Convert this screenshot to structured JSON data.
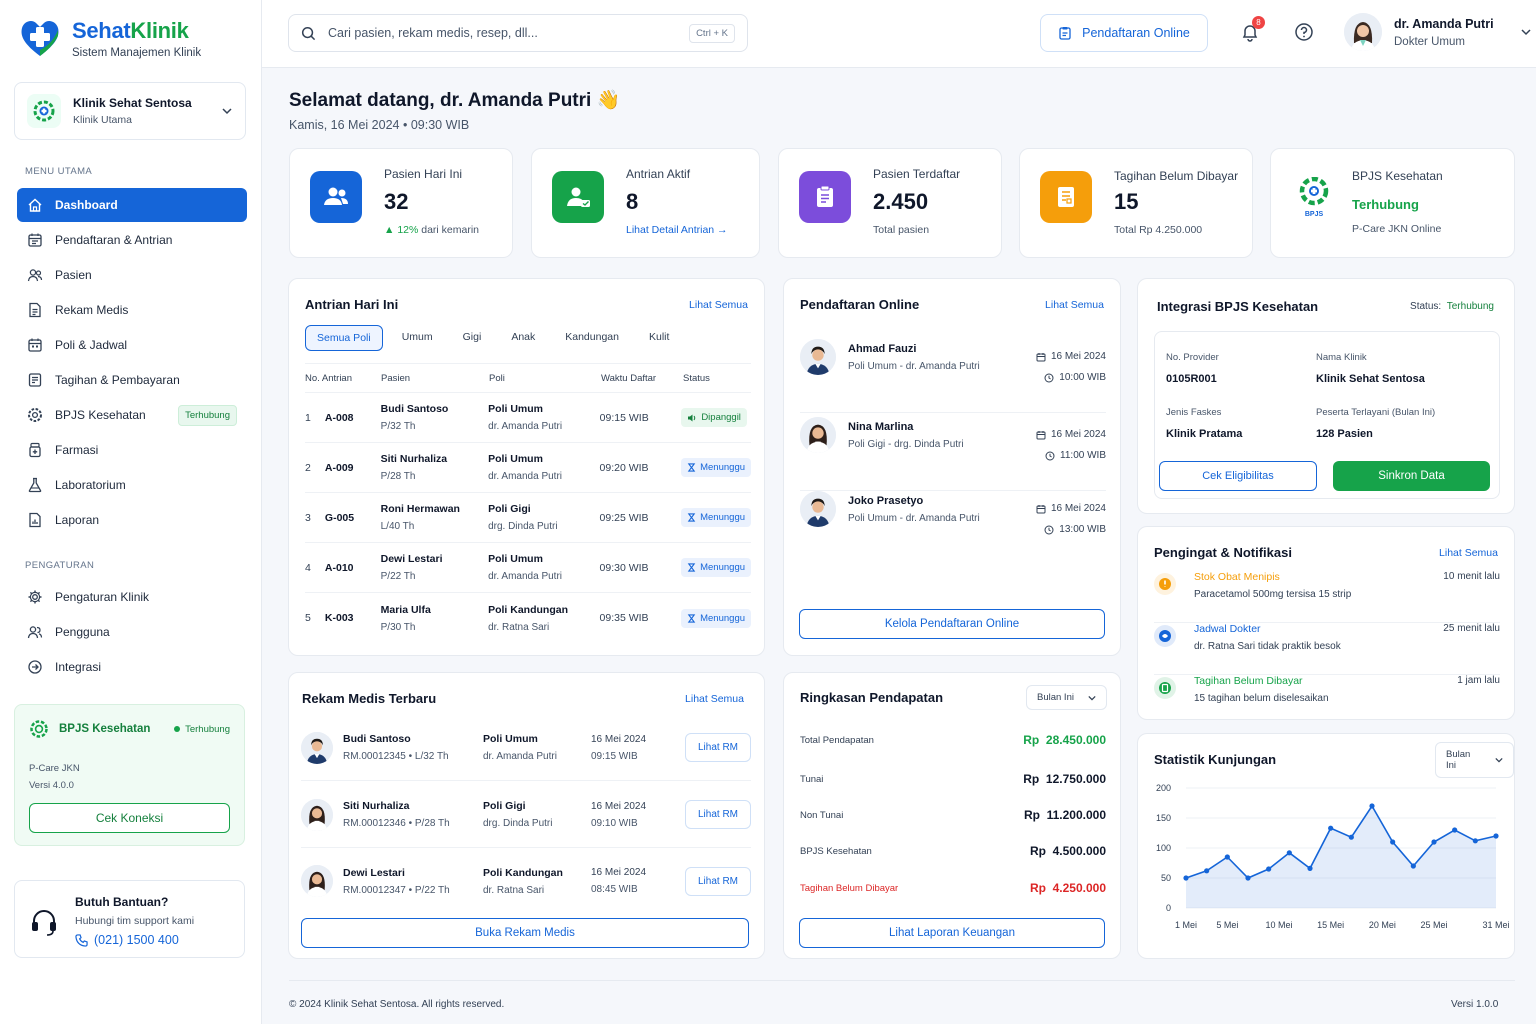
{
  "brand": {
    "name_part1": "Sehat",
    "name_part2": "Klinik",
    "subtitle": "Sistem Manajemen Klinik"
  },
  "clinic": {
    "name": "Klinik Sehat Sentosa",
    "type": "Klinik Utama"
  },
  "sidebar": {
    "menu_heading": "MENU UTAMA",
    "items": [
      {
        "label": "Dashboard",
        "icon": "home-icon",
        "active": true
      },
      {
        "label": "Pendaftaran & Antrian",
        "icon": "calendar-list-icon"
      },
      {
        "label": "Pasien",
        "icon": "users-icon"
      },
      {
        "label": "Rekam Medis",
        "icon": "document-icon"
      },
      {
        "label": "Poli & Jadwal",
        "icon": "calendar-icon"
      },
      {
        "label": "Tagihan & Pembayaran",
        "icon": "invoice-icon"
      },
      {
        "label": "BPJS Kesehatan",
        "icon": "gear-badge-icon",
        "badge": "Terhubung"
      },
      {
        "label": "Farmasi",
        "icon": "pharmacy-icon"
      },
      {
        "label": "Laboratorium",
        "icon": "flask-icon"
      },
      {
        "label": "Laporan",
        "icon": "report-icon"
      }
    ],
    "settings_heading": "PENGATURAN",
    "settings": [
      {
        "label": "Pengaturan Klinik",
        "icon": "gear-icon"
      },
      {
        "label": "Pengguna",
        "icon": "user-group-icon"
      },
      {
        "label": "Integrasi",
        "icon": "integration-icon"
      }
    ],
    "bpjs_card": {
      "title": "BPJS Kesehatan",
      "status": "Terhubung",
      "line1": "P-Care JKN",
      "line2": "Versi 4.0.0",
      "button": "Cek Koneksi"
    },
    "help": {
      "title": "Butuh Bantuan?",
      "subtitle": "Hubungi tim support kami",
      "phone": "(021) 1500 400"
    }
  },
  "topbar": {
    "search_placeholder": "Cari pasien, rekam medis, resep, dll...",
    "shortcut": "Ctrl + K",
    "online_button": "Pendaftaran Online",
    "notif_count": "8",
    "user_name": "dr. Amanda Putri",
    "user_role": "Dokter Umum"
  },
  "header": {
    "greeting": "Selamat datang, dr. Amanda Putri",
    "emoji": "👋",
    "date": "Kamis, 16 Mei 2024",
    "time": "09:30 WIB"
  },
  "stats": [
    {
      "label": "Pasien Hari Ini",
      "value": "32",
      "sub": "12%",
      "sub_suffix": "dari kemarin",
      "color": "#1565d8"
    },
    {
      "label": "Antrian Aktif",
      "value": "8",
      "sub": "Lihat Detail Antrian",
      "color": "#16a34a"
    },
    {
      "label": "Pasien Terdaftar",
      "value": "2.450",
      "sub": "Total pasien",
      "color": "#7c4ddb"
    },
    {
      "label": "Tagihan Belum Dibayar",
      "value": "15",
      "sub": "Total Rp 4.250.000",
      "color": "#f59e0b"
    },
    {
      "label": "BPJS Kesehatan",
      "value": "Terhubung",
      "sub": "P-Care JKN Online",
      "logo_text": "BPJS"
    }
  ],
  "queue": {
    "title": "Antrian Hari Ini",
    "link": "Lihat Semua",
    "tabs": [
      "Semua Poli",
      "Umum",
      "Gigi",
      "Anak",
      "Kandungan",
      "Kulit"
    ],
    "headers": [
      "No. Antrian",
      "Pasien",
      "Poli",
      "Waktu Daftar",
      "Status"
    ],
    "rows": [
      {
        "no": "1",
        "code": "A-008",
        "name": "Budi Santoso",
        "meta": "P/32 Th",
        "poli": "Poli Umum",
        "doctor": "dr. Amanda Putri",
        "time": "09:15 WIB",
        "status": "Dipanggil",
        "kind": "called"
      },
      {
        "no": "2",
        "code": "A-009",
        "name": "Siti Nurhaliza",
        "meta": "P/28 Th",
        "poli": "Poli Umum",
        "doctor": "dr. Amanda Putri",
        "time": "09:20 WIB",
        "status": "Menunggu",
        "kind": "wait"
      },
      {
        "no": "3",
        "code": "G-005",
        "name": "Roni Hermawan",
        "meta": "L/40 Th",
        "poli": "Poli Gigi",
        "doctor": "drg. Dinda Putri",
        "time": "09:25 WIB",
        "status": "Menunggu",
        "kind": "wait"
      },
      {
        "no": "4",
        "code": "A-010",
        "name": "Dewi Lestari",
        "meta": "P/22 Th",
        "poli": "Poli Umum",
        "doctor": "dr. Amanda Putri",
        "time": "09:30 WIB",
        "status": "Menunggu",
        "kind": "wait"
      },
      {
        "no": "5",
        "code": "K-003",
        "name": "Maria Ulfa",
        "meta": "P/30 Th",
        "poli": "Poli Kandungan",
        "doctor": "dr. Ratna Sari",
        "time": "09:35 WIB",
        "status": "Menunggu",
        "kind": "wait"
      }
    ]
  },
  "online": {
    "title": "Pendaftaran Online",
    "link": "Lihat Semua",
    "button": "Kelola Pendaftaran Online",
    "items": [
      {
        "name": "Ahmad Fauzi",
        "detail": "Poli Umum - dr. Amanda Putri",
        "date": "16 Mei 2024",
        "time": "10:00 WIB",
        "gender": "m"
      },
      {
        "name": "Nina Marlina",
        "detail": "Poli Gigi - drg. Dinda Putri",
        "date": "16 Mei 2024",
        "time": "11:00 WIB",
        "gender": "f"
      },
      {
        "name": "Joko Prasetyo",
        "detail": "Poli Umum - dr. Amanda Putri",
        "date": "16 Mei 2024",
        "time": "13:00 WIB",
        "gender": "m"
      }
    ]
  },
  "bpjs": {
    "title": "Integrasi BPJS Kesehatan",
    "status_label": "Status:",
    "status": "Terhubung",
    "provider_label": "No. Provider",
    "provider": "0105R001",
    "clinic_label": "Nama Klinik",
    "clinic": "Klinik Sehat Sentosa",
    "faskes_label": "Jenis Faskes",
    "faskes": "Klinik Pratama",
    "served_label": "Peserta Terlayani (Bulan Ini)",
    "served": "128 Pasien",
    "btn_check": "Cek Eligibilitas",
    "btn_sync": "Sinkron Data"
  },
  "reminders": {
    "title": "Pengingat & Notifikasi",
    "link": "Lihat Semua",
    "items": [
      {
        "title": "Stok Obat Menipis",
        "desc": "Paracetamol 500mg tersisa 15 strip",
        "time": "10 menit lalu",
        "color": "#f59e0b"
      },
      {
        "title": "Jadwal Dokter",
        "desc": "dr. Ratna Sari tidak praktik besok",
        "time": "25 menit lalu",
        "color": "#1565d8"
      },
      {
        "title": "Tagihan Belum Dibayar",
        "desc": "15 tagihan belum diselesaikan",
        "time": "1 jam lalu",
        "color": "#16a34a"
      }
    ]
  },
  "records": {
    "title": "Rekam Medis Terbaru",
    "link": "Lihat Semua",
    "button": "Buka Rekam Medis",
    "items": [
      {
        "name": "Budi Santoso",
        "id": "RM.00012345",
        "meta": "L/32 Th",
        "poli": "Poli Umum",
        "doctor": "dr. Amanda Putri",
        "date": "16 Mei 2024",
        "time": "09:15 WIB",
        "action": "Lihat RM",
        "gender": "m"
      },
      {
        "name": "Siti Nurhaliza",
        "id": "RM.00012346",
        "meta": "P/28 Th",
        "poli": "Poli Gigi",
        "doctor": "drg. Dinda Putri",
        "date": "16 Mei 2024",
        "time": "09:10 WIB",
        "action": "Lihat RM",
        "gender": "f"
      },
      {
        "name": "Dewi Lestari",
        "id": "RM.00012347",
        "meta": "P/22 Th",
        "poli": "Poli Kandungan",
        "doctor": "dr. Ratna Sari",
        "date": "16 Mei 2024",
        "time": "08:45 WIB",
        "action": "Lihat RM",
        "gender": "f"
      }
    ]
  },
  "revenue": {
    "title": "Ringkasan Pendapatan",
    "period": "Bulan Ini",
    "button": "Lihat Laporan Keuangan",
    "rows": [
      {
        "label": "Total Pendapatan",
        "value": "Rp  28.450.000",
        "kind": "total"
      },
      {
        "label": "Tunai",
        "value": "Rp  12.750.000",
        "kind": "normal"
      },
      {
        "label": "Non Tunai",
        "value": "Rp  11.200.000",
        "kind": "normal"
      },
      {
        "label": "BPJS Kesehatan",
        "value": "Rp  4.500.000",
        "kind": "normal"
      },
      {
        "label": "Tagihan Belum Dibayar",
        "value": "Rp  4.250.000",
        "kind": "due"
      }
    ]
  },
  "visits": {
    "title": "Statistik Kunjungan",
    "period": "Bulan Ini"
  },
  "chart_data": {
    "type": "area",
    "title": "Statistik Kunjungan",
    "ylim": [
      0,
      200
    ],
    "yticks": [
      0,
      50,
      100,
      150,
      200
    ],
    "xtick_labels": [
      "1 Mei",
      "5 Mei",
      "10 Mei",
      "15 Mei",
      "20 Mei",
      "25 Mei",
      "31 Mei"
    ],
    "x": [
      1,
      3,
      5,
      7,
      9,
      11,
      13,
      15,
      17,
      19,
      21,
      23,
      25,
      27,
      29,
      31
    ],
    "values": [
      50,
      62,
      85,
      50,
      65,
      92,
      66,
      133,
      118,
      170,
      110,
      70,
      110,
      130,
      112,
      120
    ],
    "color": "#1565d8"
  },
  "footer": {
    "copyright": "© 2024 Klinik Sehat Sentosa. All rights reserved.",
    "version": "Versi 1.0.0"
  }
}
